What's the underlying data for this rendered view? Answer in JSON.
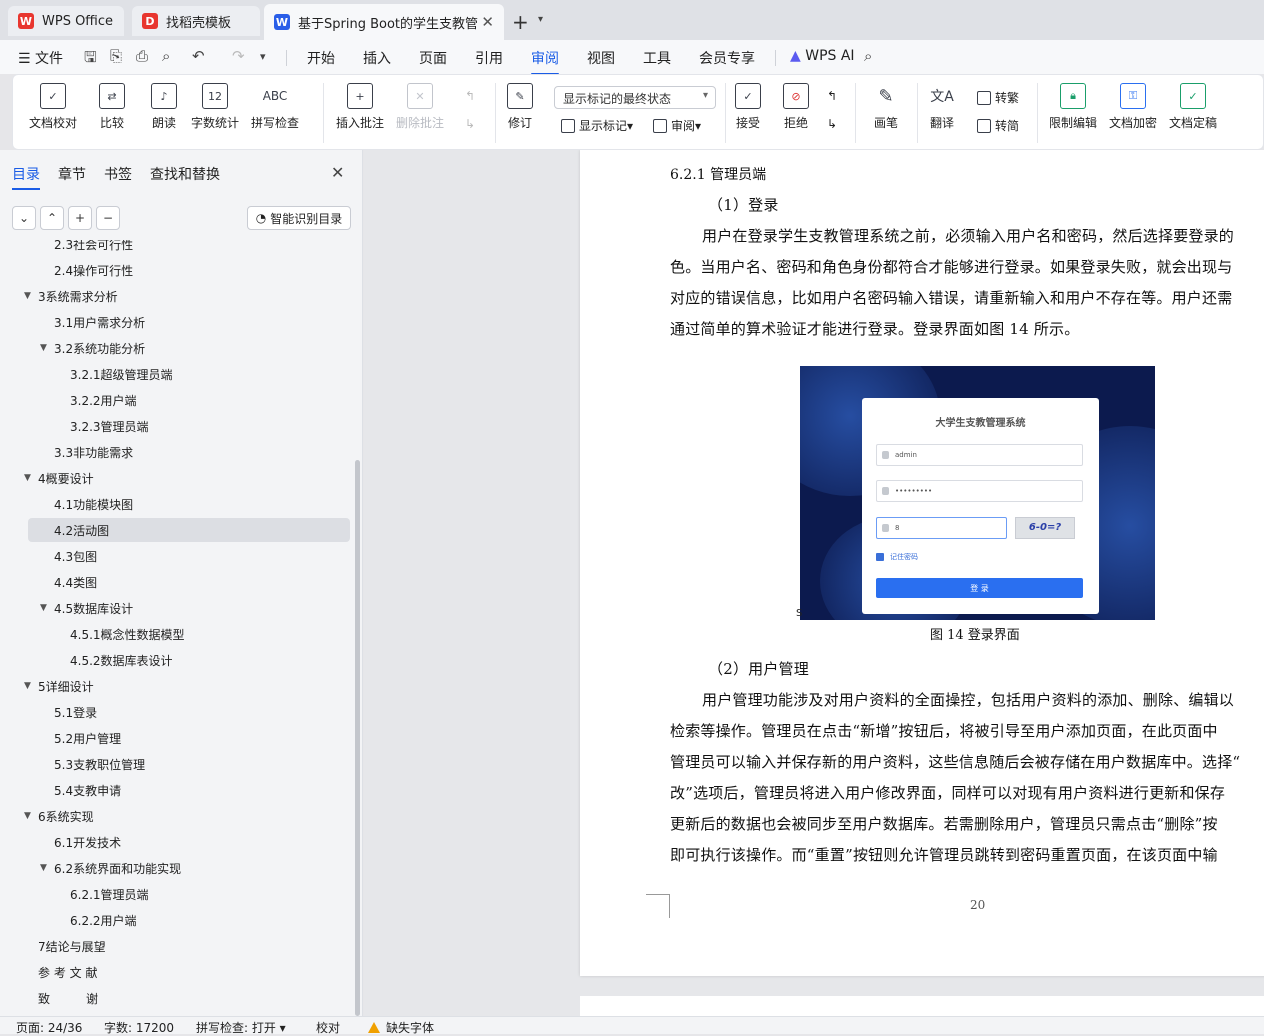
{
  "tabs": [
    {
      "label": "WPS Office",
      "icon": "wps-logo-icon"
    },
    {
      "label": "找稻壳模板",
      "icon": "docer-icon"
    },
    {
      "label": "基于Spring Boot的学生支教管",
      "icon": "word-doc-icon"
    }
  ],
  "menu": {
    "file": "文件",
    "items": [
      "开始",
      "插入",
      "页面",
      "引用",
      "审阅",
      "视图",
      "工具",
      "会员专享"
    ],
    "active": "审阅",
    "ai": "WPS AI"
  },
  "ribbon": {
    "doc_check": "文档校对",
    "compare": "比较",
    "read_aloud": "朗读",
    "word_count": "字数统计",
    "spell_check": "拼写检查",
    "insert_comment": "插入批注",
    "delete_comment": "删除批注",
    "revise": "修订",
    "markup_mode": "显示标记的最终状态",
    "show_markup": "显示标记",
    "review_pane": "审阅",
    "accept": "接受",
    "reject": "拒绝",
    "pen": "画笔",
    "translate": "翻译",
    "to_traditional": "转繁",
    "to_simplified": "转简",
    "restrict_edit": "限制编辑",
    "encrypt": "文档加密",
    "finalize": "文档定稿"
  },
  "sidebar": {
    "tabs": [
      "目录",
      "章节",
      "书签",
      "查找和替换"
    ],
    "active_tab": "目录",
    "smart_toc": "智能识别目录",
    "toc": [
      {
        "label": "2.3社会可行性",
        "level": 2
      },
      {
        "label": "2.4操作可行性",
        "level": 2
      },
      {
        "label": "3系统需求分析",
        "level": 1,
        "expanded": true
      },
      {
        "label": "3.1用户需求分析",
        "level": 2
      },
      {
        "label": "3.2系统功能分析",
        "level": 2,
        "expanded": true
      },
      {
        "label": "3.2.1超级管理员端",
        "level": 3
      },
      {
        "label": "3.2.2用户端",
        "level": 3
      },
      {
        "label": "3.2.3管理员端",
        "level": 3
      },
      {
        "label": "3.3非功能需求",
        "level": 2
      },
      {
        "label": "4概要设计",
        "level": 1,
        "expanded": true
      },
      {
        "label": "4.1功能模块图",
        "level": 2
      },
      {
        "label": "4.2活动图",
        "level": 2,
        "selected": true
      },
      {
        "label": "4.3包图",
        "level": 2
      },
      {
        "label": "4.4类图",
        "level": 2
      },
      {
        "label": "4.5数据库设计",
        "level": 2,
        "expanded": true
      },
      {
        "label": "4.5.1概念性数据模型",
        "level": 3
      },
      {
        "label": "4.5.2数据库表设计",
        "level": 3
      },
      {
        "label": "5详细设计",
        "level": 1,
        "expanded": true
      },
      {
        "label": "5.1登录",
        "level": 2
      },
      {
        "label": "5.2用户管理",
        "level": 2
      },
      {
        "label": "5.3支教职位管理",
        "level": 2
      },
      {
        "label": "5.4支教申请",
        "level": 2
      },
      {
        "label": "6系统实现",
        "level": 1,
        "expanded": true
      },
      {
        "label": "6.1开发技术",
        "level": 2
      },
      {
        "label": "6.2系统界面和功能实现",
        "level": 2,
        "expanded": true
      },
      {
        "label": "6.2.1管理员端",
        "level": 3
      },
      {
        "label": "6.2.2用户端",
        "level": 3
      },
      {
        "label": "7结论与展望",
        "level": 1
      },
      {
        "label": "参 考 文 献",
        "level": 1
      },
      {
        "label": "致　　　谢",
        "level": 1
      }
    ]
  },
  "document": {
    "heading": "6.2.1 管理员端",
    "sub1": "（1）登录",
    "para1": [
      "用户在登录学生支教管理系统之前，必须输入用户名和密码，然后选择要登录的",
      "色。当用户名、密码和角色身份都符合才能够进行登录。如果登录失败，就会出现与",
      "对应的错误信息，比如用户名密码输入错误，请重新输入和用户不存在等。用户还需",
      "通过简单的算术验证才能进行登录。登录界面如图 14 所示。"
    ],
    "figure": {
      "title": "大学生支教管理系统",
      "username": "admin",
      "password": "•••••••••",
      "captcha_input": "8",
      "captcha": "6-0=?",
      "remember": "记住密码",
      "login_button": "登 录",
      "stray_char": "S"
    },
    "caption": "图 14  登录界面",
    "sub2": "（2）用户管理",
    "para2": [
      "用户管理功能涉及对用户资料的全面操控，包括用户资料的添加、删除、编辑以",
      "检索等操作。管理员在点击“新增”按钮后，将被引导至用户添加页面，在此页面中",
      "管理员可以输入并保存新的用户资料，这些信息随后会被存储在用户数据库中。选择“",
      "改”选项后，管理员将进入用户修改界面，同样可以对现有用户资料进行更新和保存",
      "更新后的数据也会被同步至用户数据库。若需删除用户，管理员只需点击“删除”按",
      "即可执行该操作。而“重置”按钮则允许管理员跳转到密码重置页面，在该页面中输"
    ],
    "page_number": "20"
  },
  "status": {
    "page": "页面: 24/36",
    "words": "字数: 17200",
    "spell": "拼写检查: 打开",
    "proof": "校对",
    "missing_font": "缺失字体"
  },
  "colors": {
    "accent": "#1a5ce6",
    "login_bg": "#0c1a4e",
    "warn": "#f0a000"
  }
}
